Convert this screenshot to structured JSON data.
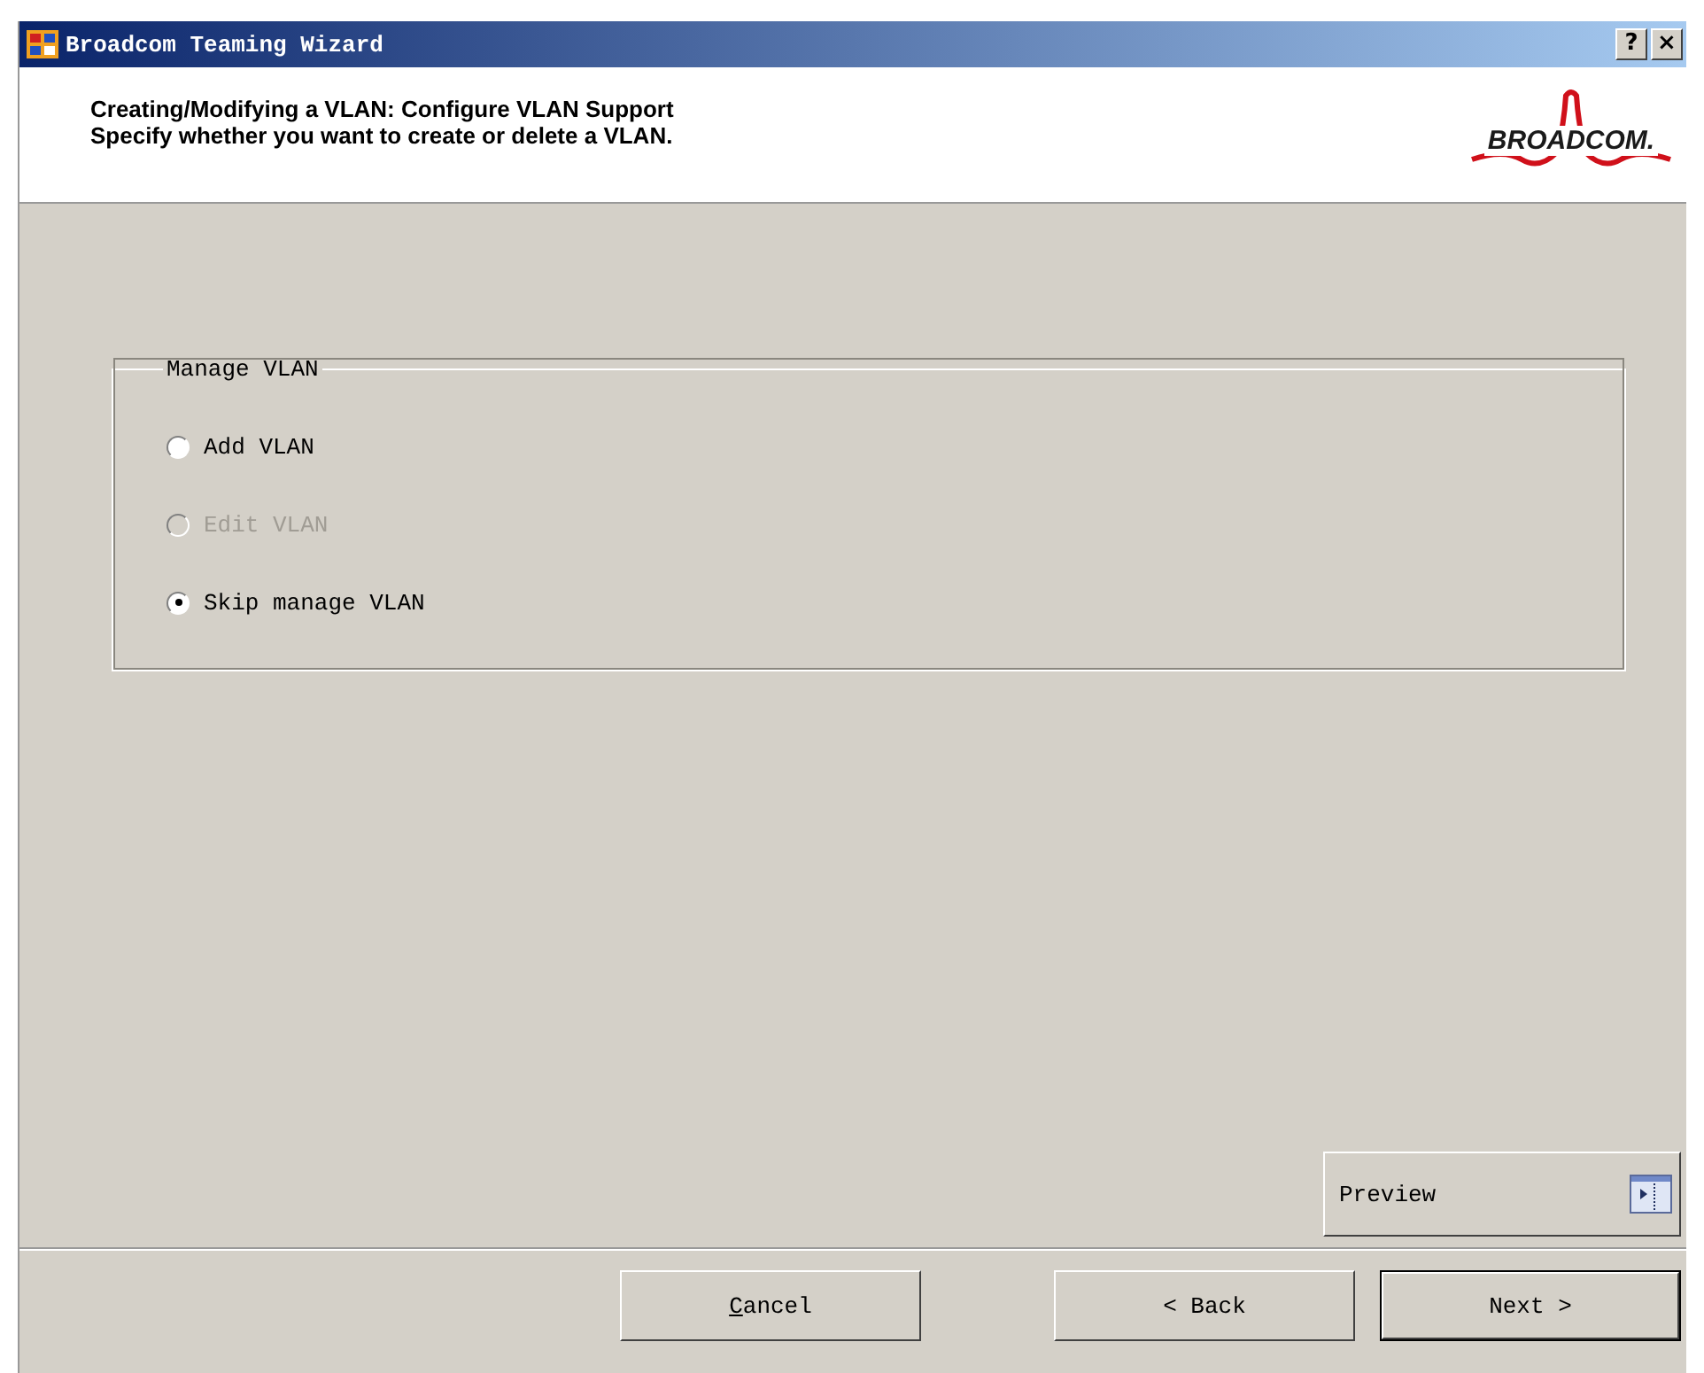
{
  "window": {
    "title": "Broadcom Teaming Wizard",
    "title_buttons": [
      "?",
      "×"
    ]
  },
  "header": {
    "title": "Creating/Modifying a VLAN:  Configure VLAN Support",
    "subtitle": "Specify whether you want to create or delete a VLAN.",
    "logo": "BROADCOM."
  },
  "group": {
    "label": "Manage VLAN",
    "options": [
      {
        "label": "Add VLAN",
        "selected": false,
        "disabled": false
      },
      {
        "label": "Edit VLAN",
        "selected": false,
        "disabled": true
      },
      {
        "label": "Skip manage VLAN",
        "selected": true,
        "disabled": false
      }
    ]
  },
  "preview": {
    "label": "Preview"
  },
  "buttons": [
    {
      "label": "Cancel",
      "underline_first": true,
      "default": false
    },
    {
      "label": "< Back",
      "underline_first": false,
      "default": false
    },
    {
      "label": "Next >",
      "underline_first": false,
      "default": true
    }
  ]
}
